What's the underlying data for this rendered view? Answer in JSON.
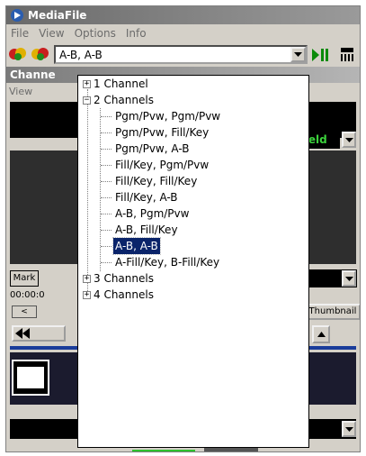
{
  "window": {
    "title": "MediaFile"
  },
  "menu": [
    "File",
    "View",
    "Options",
    "Info"
  ],
  "toolbar": {
    "combo_value": "A-B, A-B"
  },
  "panel": {
    "title": "Channe",
    "view_label": "View"
  },
  "status": {
    "field_label": "field"
  },
  "controls": {
    "mark_label": "Mark",
    "timecode": "00:00:0",
    "thumbnail_label": "Thumbnail"
  },
  "tree": {
    "groups": [
      {
        "label": "1 Channel",
        "expanded": false
      },
      {
        "label": "2 Channels",
        "expanded": true,
        "items": [
          "Pgm/Pvw, Pgm/Pvw",
          "Pgm/Pvw, Fill/Key",
          "Pgm/Pvw, A-B",
          "Fill/Key, Pgm/Pvw",
          "Fill/Key, Fill/Key",
          "Fill/Key, A-B",
          "A-B, Pgm/Pvw",
          "A-B, Fill/Key",
          "A-B, A-B",
          "A-Fill/Key, B-Fill/Key"
        ],
        "selected_index": 8
      },
      {
        "label": "3 Channels",
        "expanded": false
      },
      {
        "label": "4 Channels",
        "expanded": false
      }
    ]
  },
  "colors": {
    "selection": "#0a246a",
    "field_text": "#3cd23c"
  }
}
